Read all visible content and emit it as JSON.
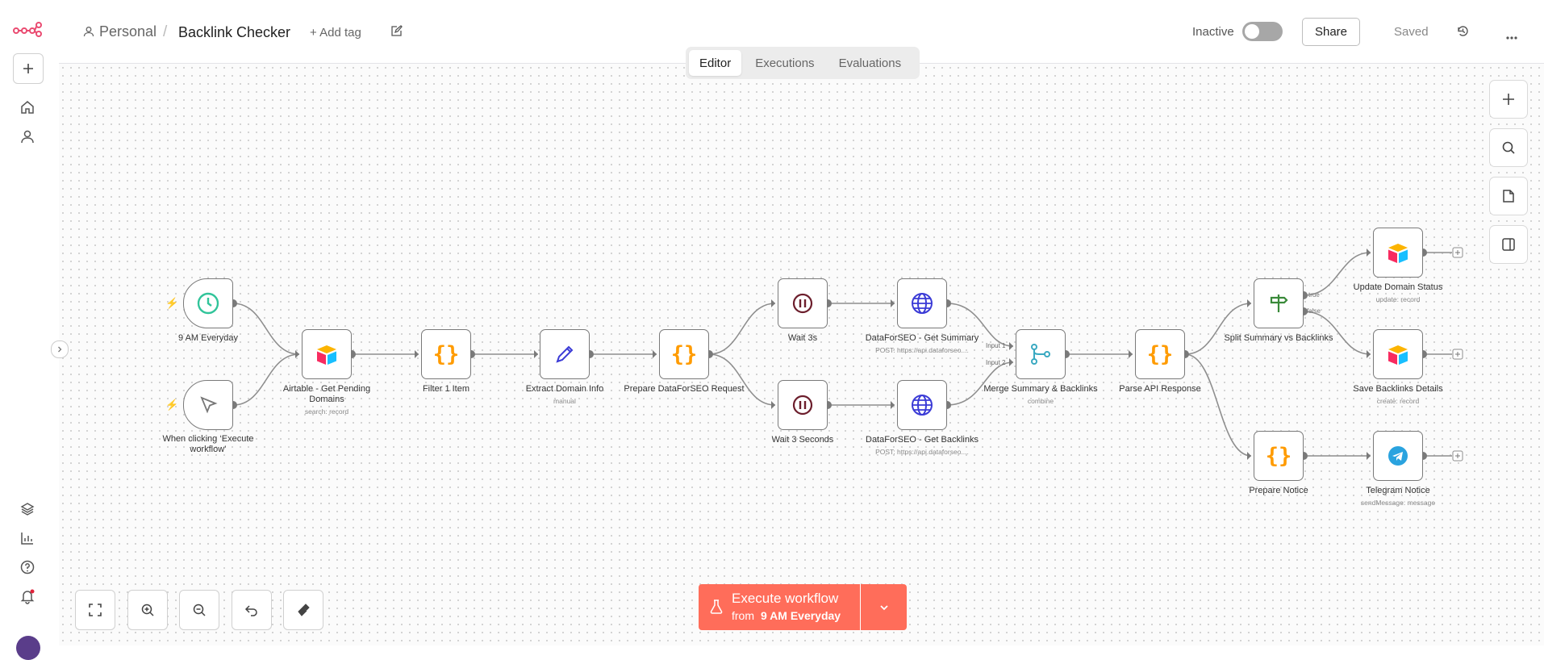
{
  "header": {
    "project": "Personal",
    "separator": "/",
    "workflow_name": "Backlink Checker",
    "add_tag": "+ Add tag",
    "status_label": "Inactive",
    "share": "Share",
    "saved": "Saved"
  },
  "tabs": [
    "Editor",
    "Executions",
    "Evaluations"
  ],
  "nodes": {
    "schedule": {
      "label": "9 AM Everyday",
      "sub": ""
    },
    "manual": {
      "label": "When clicking ‘Execute workflow’",
      "sub": ""
    },
    "airtable_get": {
      "label": "Airtable - Get Pending Domains",
      "sub": "search: record"
    },
    "filter": {
      "label": "Filter 1 Item",
      "sub": ""
    },
    "extract": {
      "label": "Extract Domain Info",
      "sub": "manual"
    },
    "prepare_request": {
      "label": "Prepare DataForSEO Request",
      "sub": ""
    },
    "wait1": {
      "label": "Wait 3s",
      "sub": ""
    },
    "wait2": {
      "label": "Wait 3 Seconds",
      "sub": ""
    },
    "dfs_summary": {
      "label": "DataForSEO - Get Summary",
      "sub": "POST: https://api.dataforseo...."
    },
    "dfs_backlinks": {
      "label": "DataForSEO - Get Backlinks",
      "sub": "POST: https://api.dataforseo...."
    },
    "merge": {
      "label": "Merge Summary & Backlinks",
      "sub": "combine",
      "input1": "Input 1",
      "input2": "Input 2"
    },
    "parse": {
      "label": "Parse API Response",
      "sub": ""
    },
    "split": {
      "label": "Split Summary vs Backlinks",
      "sub": "",
      "true": "true",
      "false": "false"
    },
    "update_status": {
      "label": "Update Domain Status",
      "sub": "update: record"
    },
    "save_backlinks": {
      "label": "Save Backlinks Details",
      "sub": "create: record"
    },
    "prepare_notice": {
      "label": "Prepare Notice",
      "sub": ""
    },
    "telegram": {
      "label": "Telegram Notice",
      "sub": "sendMessage: message"
    }
  },
  "execute": {
    "title": "Execute workflow",
    "sub_prefix": "from",
    "sub_node": "9 AM Everyday"
  },
  "colors": {
    "accent": "#ff6d5a",
    "code": "#ff9b00",
    "wait": "#6c1e2c",
    "globe": "#3b3bd6",
    "merge": "#3aa9c1",
    "split": "#3a8a3a",
    "telegram": "#2aa3df"
  }
}
